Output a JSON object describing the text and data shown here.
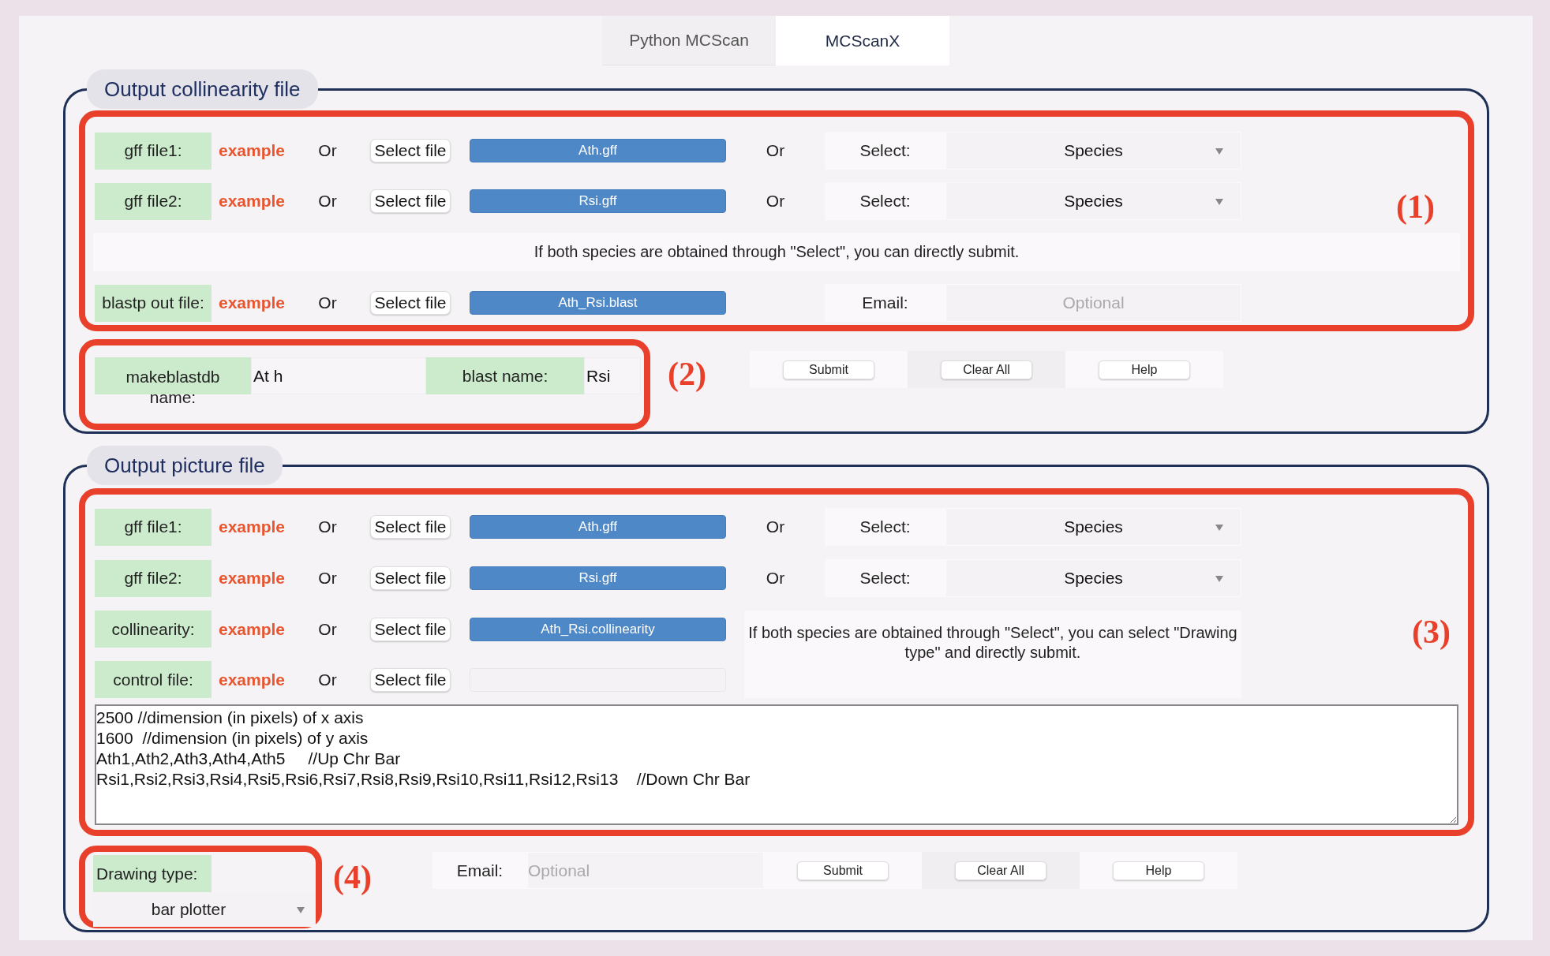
{
  "tabs": [
    {
      "label": "Python MCScan",
      "selected": false
    },
    {
      "label": "MCScanX",
      "selected": true
    }
  ],
  "collinearity_section": {
    "title": "Output collinearity file",
    "annotation": "(1)",
    "file_rows": [
      {
        "label": "gff file1:",
        "example": "example",
        "or": "Or",
        "select_button": "Select file",
        "file_name": "Ath.gff",
        "or_2": "Or",
        "select_label": "Select:",
        "dropdown": "Species"
      },
      {
        "label": "gff file2:",
        "example": "example",
        "or": "Or",
        "select_button": "Select file",
        "file_name": "Rsi.gff",
        "or_2": "Or",
        "select_label": "Select:",
        "dropdown": "Species"
      }
    ],
    "note": "If both species are obtained through \"Select\", you can directly submit.",
    "blastp_row": {
      "label": "blastp out file:",
      "example": "example",
      "or": "Or",
      "select_button": "Select file",
      "file_name": "Ath_Rsi.blast",
      "email_label": "Email:",
      "email_placeholder": "Optional"
    },
    "blast_box": {
      "annotation": "(2)",
      "makeblastdb_label": "makeblastdb name:",
      "makeblastdb_value": "At h",
      "blast_name_label": "blast name:",
      "blast_name_value": "Rsi"
    },
    "buttons": [
      "Submit",
      "Clear All",
      "Help"
    ]
  },
  "picture_section": {
    "title": "Output picture file",
    "annotation": "(3)",
    "file_rows": [
      {
        "label": "gff file1:",
        "example": "example",
        "or": "Or",
        "select_button": "Select file",
        "file_name": "Ath.gff",
        "or_2": "Or",
        "select_label": "Select:",
        "dropdown": "Species"
      },
      {
        "label": "gff file2:",
        "example": "example",
        "or": "Or",
        "select_button": "Select file",
        "file_name": "Rsi.gff",
        "or_2": "Or",
        "select_label": "Select:",
        "dropdown": "Species"
      },
      {
        "label": "collinearity:",
        "example": "example",
        "or": "Or",
        "select_button": "Select file",
        "file_name": "Ath_Rsi.collinearity"
      },
      {
        "label": "control file:",
        "example": "example",
        "or": "Or",
        "select_button": "Select file"
      }
    ],
    "note": "If both species are obtained through \"Select\", you can select \"Drawing type\" and directly submit.",
    "control_text": "2500 //dimension (in pixels) of x axis\n1600  //dimension (in pixels) of y axis\nAth1,Ath2,Ath3,Ath4,Ath5     //Up Chr Bar\nRsi1,Rsi2,Rsi3,Rsi4,Rsi5,Rsi6,Rsi7,Rsi8,Rsi9,Rsi10,Rsi11,Rsi12,Rsi13    //Down Chr Bar",
    "drawing_box": {
      "annotation": "(4)",
      "label": "Drawing type:",
      "dropdown": "bar plotter"
    },
    "email_label": "Email:",
    "email_placeholder": "Optional",
    "buttons": [
      "Submit",
      "Clear All",
      "Help"
    ]
  }
}
